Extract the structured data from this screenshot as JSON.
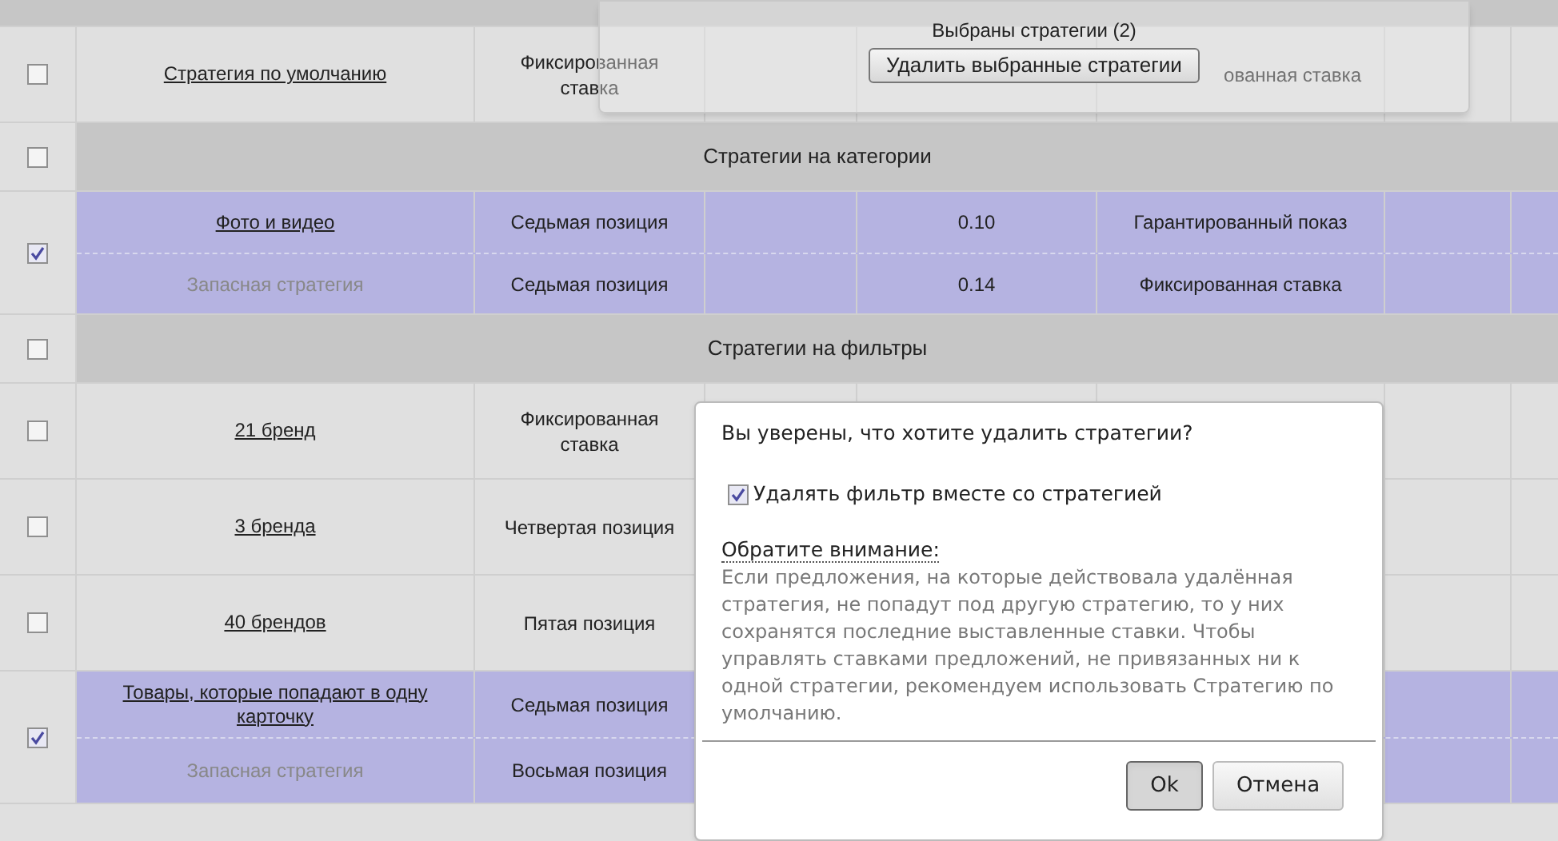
{
  "table": {
    "rows": [
      {
        "kind": "strategy",
        "checked": false,
        "lines": [
          {
            "kind": "main",
            "name": "Стратегия по умолчанию",
            "type": "Фиксированная ставка",
            "mode": "ованная ставка"
          }
        ]
      },
      {
        "kind": "group",
        "checked": false,
        "title": "Стратегии на категории"
      },
      {
        "kind": "strategy",
        "checked": true,
        "lines": [
          {
            "kind": "main",
            "name": "Фото и видео",
            "type": "Седьмая позиция",
            "value": "0.10",
            "mode": "Гарантированный показ"
          },
          {
            "kind": "backup",
            "name": "Запасная стратегия",
            "type": "Седьмая позиция",
            "value": "0.14",
            "mode": "Фиксированная ставка"
          }
        ]
      },
      {
        "kind": "group",
        "checked": false,
        "title": "Стратегии на фильтры"
      },
      {
        "kind": "strategy",
        "checked": false,
        "lines": [
          {
            "kind": "main",
            "name": "21 бренд",
            "type": "Фиксированная ставка"
          }
        ]
      },
      {
        "kind": "strategy",
        "checked": false,
        "lines": [
          {
            "kind": "main",
            "name": "3 бренда",
            "type": "Четвертая позиция"
          }
        ]
      },
      {
        "kind": "strategy",
        "checked": false,
        "lines": [
          {
            "kind": "main",
            "name": "40 брендов",
            "type": "Пятая позиция"
          }
        ]
      },
      {
        "kind": "strategy",
        "checked": true,
        "lines": [
          {
            "kind": "main",
            "name": "Товары, которые попадают в одну карточку",
            "type": "Седьмая позиция"
          },
          {
            "kind": "backup",
            "name": "Запасная стратегия",
            "type": "Восьмая позиция"
          }
        ]
      }
    ]
  },
  "selection_popup": {
    "text": "Выбраны стратегии (2)",
    "button": "Удалить выбранные стратегии"
  },
  "dialog": {
    "question": "Вы уверены, что хотите удалить стратегии?",
    "option": {
      "label": "Удалять фильтр вместе со стратегией",
      "checked": true
    },
    "note_title": "Обратите внимание:",
    "note": "Если предложения, на которые действовала удалённая стратегия, не попадут под другую стратегию, то у них сохранятся последние выставленные ставки. Чтобы управлять ставками предложений, не привязанных ни к одной стратегии, рекомендуем использовать Стратегию по умолчанию.",
    "buttons": [
      {
        "label": "Ok",
        "pressed": true
      },
      {
        "label": "Отмена",
        "pressed": false
      }
    ]
  }
}
